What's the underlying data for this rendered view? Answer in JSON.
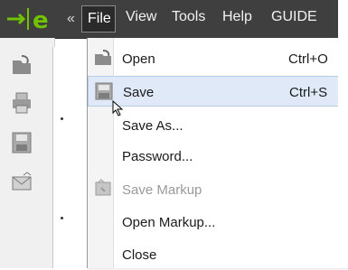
{
  "menubar": {
    "collapse_glyph": "«",
    "items": [
      "File",
      "View",
      "Tools",
      "Help",
      "GUIDE"
    ]
  },
  "file_menu": {
    "items": [
      {
        "label": "Open",
        "shortcut": "Ctrl+O",
        "icon": "open-icon",
        "disabled": false,
        "hover": false
      },
      {
        "label": "Save",
        "shortcut": "Ctrl+S",
        "icon": "save-icon",
        "disabled": false,
        "hover": true
      },
      {
        "label": "Save As...",
        "shortcut": "",
        "icon": "",
        "disabled": false,
        "hover": false
      },
      {
        "label": "Password...",
        "shortcut": "",
        "icon": "",
        "disabled": false,
        "hover": false
      },
      {
        "label": "Save Markup",
        "shortcut": "",
        "icon": "save-markup-icon",
        "disabled": true,
        "hover": false
      },
      {
        "label": "Open Markup...",
        "shortcut": "",
        "icon": "",
        "disabled": false,
        "hover": false
      },
      {
        "label": "Close",
        "shortcut": "",
        "icon": "",
        "disabled": false,
        "hover": false
      }
    ]
  },
  "colors": {
    "menubar_bg": "#3f3f3f",
    "logo_green": "#71c300",
    "hover_bg": "#dfe9f7"
  }
}
